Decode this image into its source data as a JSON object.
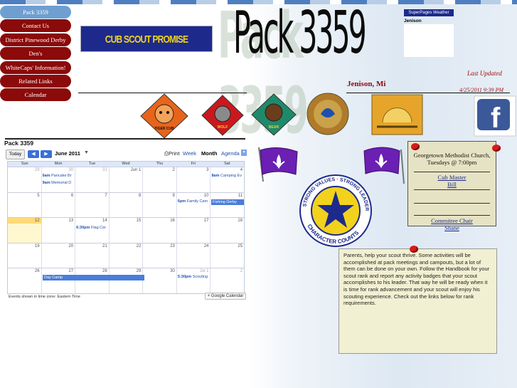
{
  "nav": {
    "items": [
      "Pack 3359",
      "Contact Us",
      "District Pinewood Derby",
      "Den's",
      "WhiteCaps' Information!",
      "Related Links",
      "Calendar"
    ]
  },
  "banner": {
    "promise_text": "CUB SCOUT PROMISE",
    "title": "Pack 3359",
    "location": "Jenison, Mi",
    "last_updated_label": "Last Updated",
    "last_updated_value": "4/25/2011 9:39 PM"
  },
  "weather": {
    "title": "SuperPages Weather",
    "city": "Jenison"
  },
  "badges": {
    "tiger_label": "TIGER CUB",
    "wolf_label": "WOLF",
    "bear_label": "BEAR"
  },
  "calendar": {
    "name": "Pack 3359",
    "today_label": "Today",
    "month_label": "June 2011",
    "print_label": "Print",
    "views": [
      "Week",
      "Month",
      "Agenda"
    ],
    "selected_view": "Month",
    "weekdays": [
      "Sun",
      "Mon",
      "Tue",
      "Wed",
      "Thu",
      "Fri",
      "Sat"
    ],
    "weeks": [
      [
        "29",
        "30",
        "31",
        "Jun 1",
        "2",
        "3",
        "4"
      ],
      [
        "5",
        "6",
        "7",
        "8",
        "9",
        "10",
        "11"
      ],
      [
        "12",
        "13",
        "14",
        "15",
        "16",
        "17",
        "18"
      ],
      [
        "19",
        "20",
        "21",
        "22",
        "23",
        "24",
        "25"
      ],
      [
        "26",
        "27",
        "28",
        "29",
        "30",
        "Jul 1",
        "2"
      ]
    ],
    "events": {
      "pancake": {
        "time": "6am",
        "title": "Pancake Br"
      },
      "memorial": {
        "time": "9am",
        "title": "Memorial D"
      },
      "camping": {
        "time": "8am",
        "title": "Camping Ev"
      },
      "family": {
        "time": "6pm",
        "title": "Family Cam"
      },
      "fishing": {
        "title": "Fishing Derby"
      },
      "flag": {
        "time": "6:30pm",
        "title": "Flag Cer"
      },
      "daycamp": {
        "title": "Day Camp"
      },
      "scouting": {
        "time": "5:30pm",
        "title": "Scouting"
      }
    },
    "timezone_note": "Events shown in time zone: Eastern Time",
    "gcal_label": "Google Calendar"
  },
  "note_meeting": {
    "place": "Georgetown Methodist Church,",
    "time": "Tuesdays @ 7:00pm",
    "cubmaster_label": "Cub Master",
    "cubmaster_name": "Bill",
    "committee_label": "Committee Chair",
    "committee_name": "Shane"
  },
  "note_parents": {
    "text": "Parents, help your scout thrive. Some activities will be accomplished at pack meetings and campouts, but a lot of them can be done on your own. Follow the Handbook for your scout rank and report any activity badges that your scout accomplishes to his leader. That way he will be ready when it is time for rank advancement and your scout will enjoy his scouting experience. Check out the links below for rank requirements."
  },
  "character_counts": {
    "ring_top": "STRONG VALUES · STRONG LEADERS",
    "ring_bottom": "CHARACTER COUNTS"
  },
  "colors": {
    "nav_red": "#8b0a0a",
    "nav_active": "#6f9fd0",
    "promise_blue": "#1d2a8c",
    "promise_yellow": "#f2d21c",
    "cal_event_blue": "#4a7dd9"
  }
}
